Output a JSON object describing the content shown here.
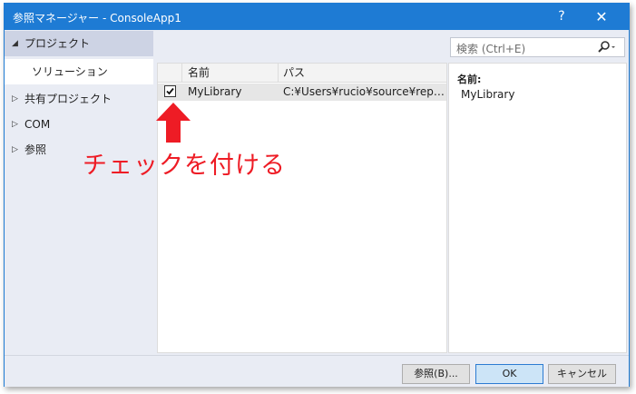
{
  "window": {
    "title": "参照マネージャー - ConsoleApp1",
    "help_glyph": "?",
    "close_glyph": "✕"
  },
  "sidebar": {
    "items": [
      {
        "label": "プロジェクト",
        "expander": "◢",
        "selected": true
      },
      {
        "label": "ソリューション",
        "expander": ""
      },
      {
        "label": "共有プロジェクト",
        "expander": "▷"
      },
      {
        "label": "COM",
        "expander": "▷"
      },
      {
        "label": "参照",
        "expander": "▷"
      }
    ]
  },
  "search": {
    "placeholder": "検索 (Ctrl+E)"
  },
  "grid": {
    "columns": [
      "名前",
      "パス"
    ],
    "rows": [
      {
        "checked": true,
        "name": "MyLibrary",
        "path": "C:¥Users¥rucio¥source¥repos¥..."
      }
    ]
  },
  "details": {
    "label": "名前:",
    "value": "MyLibrary"
  },
  "buttons": {
    "browse": "参照(B)...",
    "ok": "OK",
    "cancel": "キャンセル"
  },
  "annotation": {
    "text": "チェックを付ける",
    "color": "#ee1c25"
  },
  "colors": {
    "titlebar": "#1e7bd4",
    "accent_ok": "#cce4f7"
  }
}
